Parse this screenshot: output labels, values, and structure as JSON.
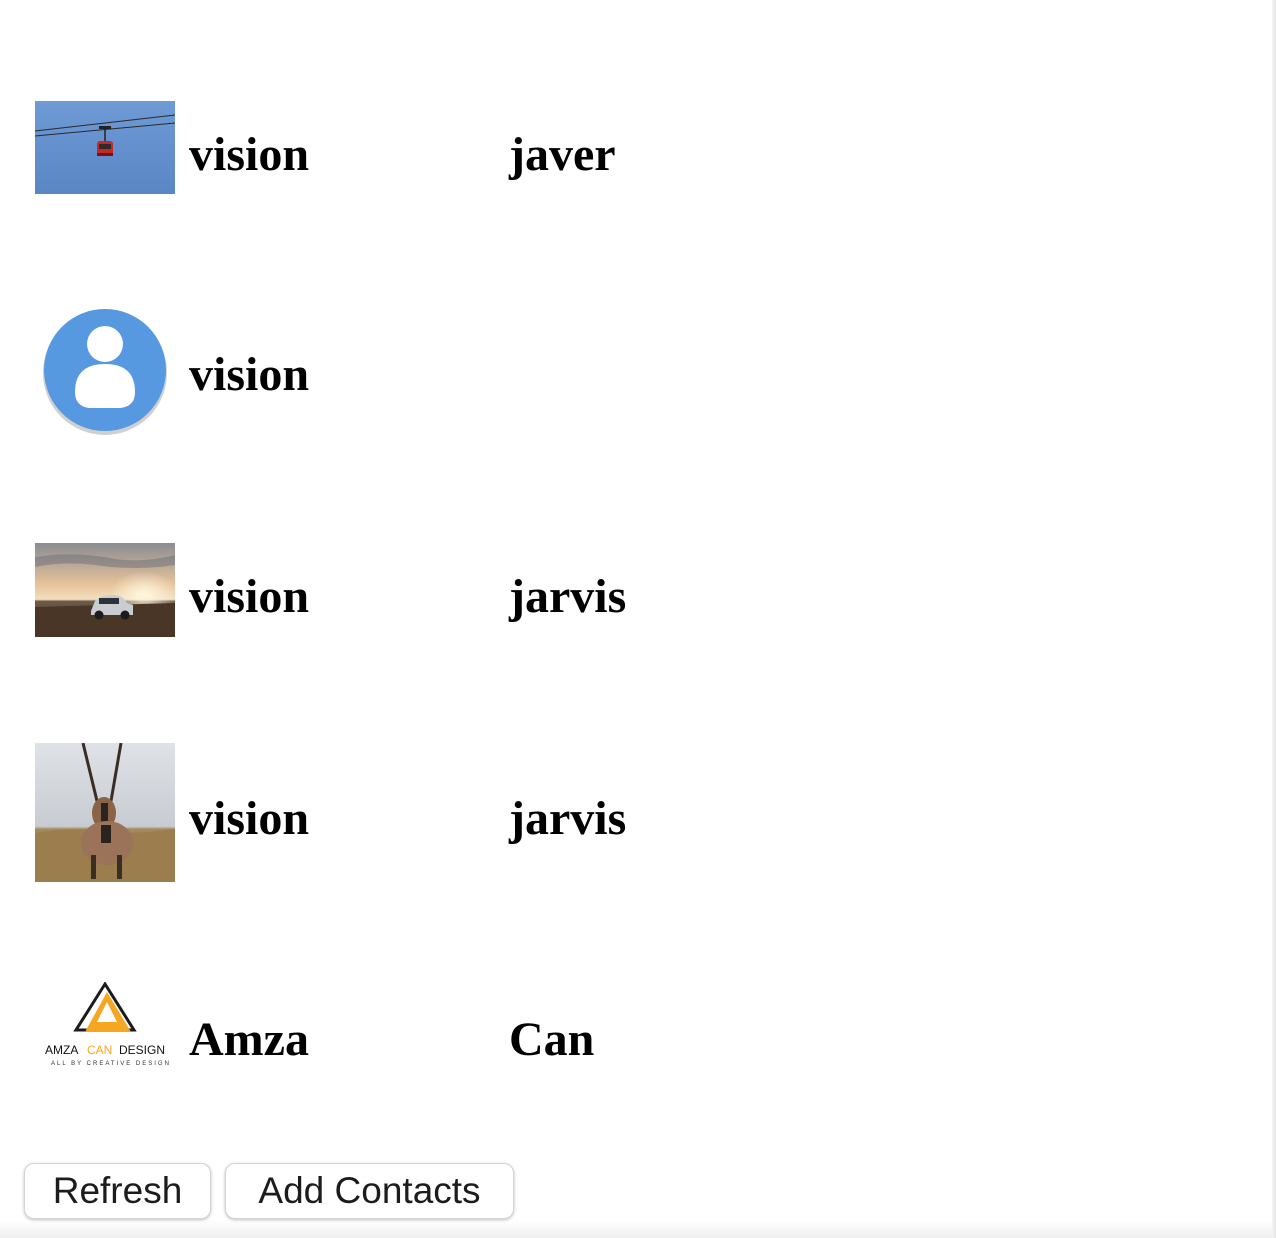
{
  "contacts": [
    {
      "first_name": "vision",
      "last_name": "javer",
      "photo": "cable-car-photo"
    },
    {
      "first_name": "vision",
      "last_name": "",
      "photo": "default-avatar-icon"
    },
    {
      "first_name": "vision",
      "last_name": "jarvis",
      "photo": "car-sunset-photo"
    },
    {
      "first_name": "vision",
      "last_name": "jarvis",
      "photo": "oryx-antelope-photo"
    },
    {
      "first_name": "Amza",
      "last_name": "Can",
      "photo": "amza-can-design-logo"
    }
  ],
  "logo_text": {
    "line1_left": "AMZA",
    "line1_mid": "CAN",
    "line1_right": "DESIGN",
    "line2": "ALL BY CREATIVE DESIGN"
  },
  "actions": {
    "refresh_label": "Refresh",
    "add_contacts_label": "Add Contacts"
  },
  "colors": {
    "avatar_blue": "#5699e0",
    "logo_orange": "#f5a623"
  }
}
